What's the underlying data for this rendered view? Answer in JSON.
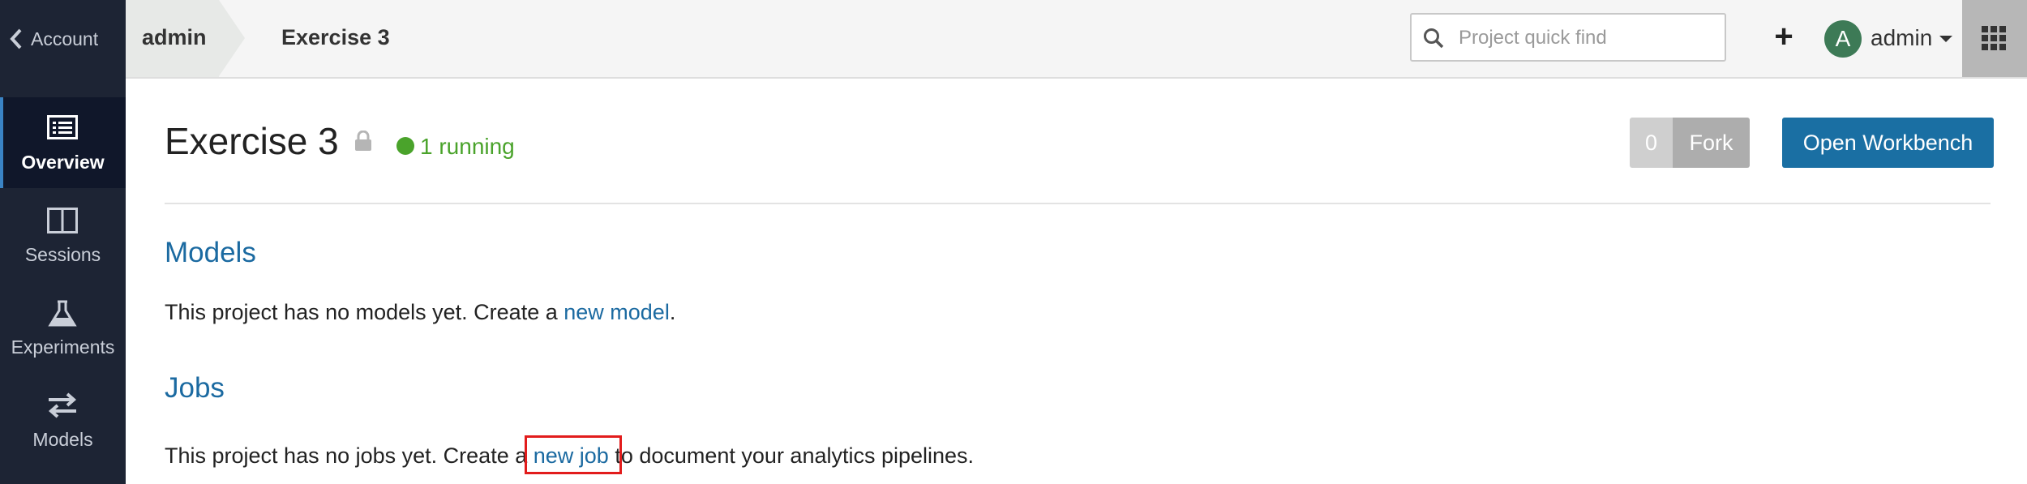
{
  "sidebar": {
    "account_label": "Account",
    "items": [
      {
        "label": "Overview",
        "icon": "overview-icon",
        "active": true
      },
      {
        "label": "Sessions",
        "icon": "sessions-icon",
        "active": false
      },
      {
        "label": "Experiments",
        "icon": "experiments-icon",
        "active": false
      },
      {
        "label": "Models",
        "icon": "models-icon",
        "active": false
      }
    ]
  },
  "header": {
    "breadcrumb_owner": "admin",
    "breadcrumb_project": "Exercise 3",
    "search_placeholder": "Project quick find",
    "search_value": "",
    "add_label": "+",
    "avatar_initial": "A",
    "user_name": "admin"
  },
  "project": {
    "title": "Exercise 3",
    "status": "1 running",
    "fork_count": "0",
    "fork_label": "Fork",
    "open_workbench_label": "Open Workbench"
  },
  "models_section": {
    "title": "Models",
    "text_before": "This project has no models yet. Create a ",
    "link": "new model",
    "text_after": "."
  },
  "jobs_section": {
    "title": "Jobs",
    "text_before": "This project has no jobs yet. Create a ",
    "link": "new job",
    "text_after": " to document your analytics pipelines."
  },
  "colors": {
    "sidebar_bg": "#1d2434",
    "link": "#1b6aa1",
    "primary_button": "#1a6fa3",
    "running_status": "#4aa32b",
    "avatar": "#3d7a56",
    "highlight": "#e21c1c"
  }
}
